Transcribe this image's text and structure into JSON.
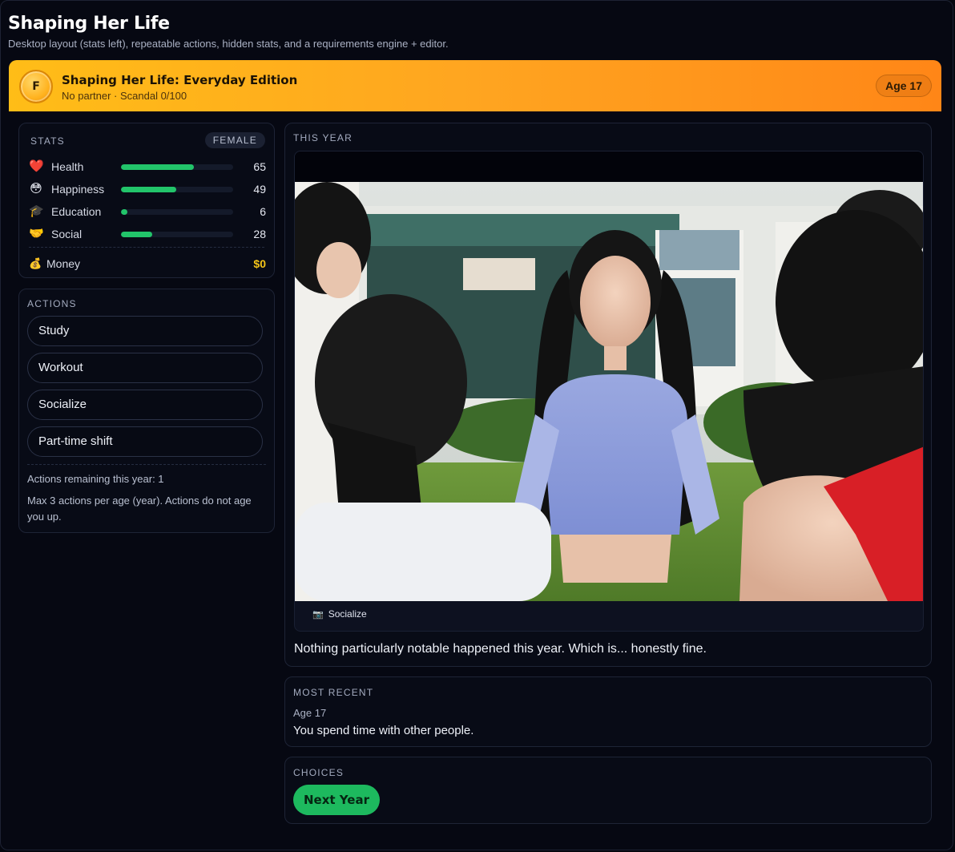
{
  "app": {
    "title": "Shaping Her Life",
    "subtitle": "Desktop layout (stats left), repeatable actions, hidden stats, and a requirements engine + editor."
  },
  "banner": {
    "avatar_letter": "F",
    "title": "Shaping Her Life: Everyday Edition",
    "subtitle": "No partner · Scandal 0/100",
    "age": "Age 17",
    "gradient": [
      "#ffbd17",
      "#ff8617"
    ]
  },
  "stats": {
    "label": "STATS",
    "gender": "FEMALE",
    "items": [
      {
        "label": "Health",
        "value": "65",
        "icon": "heart-icon",
        "glyph": "❤️",
        "percent": 65
      },
      {
        "label": "Happiness",
        "value": "49",
        "icon": "smiley-icon",
        "glyph": "😳",
        "percent": 49
      },
      {
        "label": "Education",
        "value": "6",
        "icon": "graduation-cap-icon",
        "glyph": "🎓",
        "percent": 6
      },
      {
        "label": "Social",
        "value": "28",
        "icon": "handshake-icon",
        "glyph": "🤝",
        "percent": 28
      }
    ],
    "money": {
      "label": "Money",
      "value": "$0",
      "icon": "money-bag-icon",
      "glyph": "💰"
    },
    "bar_color": "#22c46a"
  },
  "actions": {
    "label": "ACTIONS",
    "buttons": [
      "Study",
      "Workout",
      "Socialize",
      "Part-time shift"
    ],
    "remaining": "Actions remaining this year: 1",
    "note": "Max 3 actions per age (year). Actions do not age you up."
  },
  "this_year": {
    "label": "THIS YEAR",
    "image_caption": "Socialize",
    "caption_icon": "camera-icon",
    "text": "Nothing particularly notable happened this year. Which is... honestly fine."
  },
  "recent": {
    "label": "MOST RECENT",
    "age": "Age 17",
    "text": "You spend time with other people."
  },
  "choices": {
    "label": "CHOICES",
    "next_label": "Next Year",
    "accent": "#1db95e"
  }
}
